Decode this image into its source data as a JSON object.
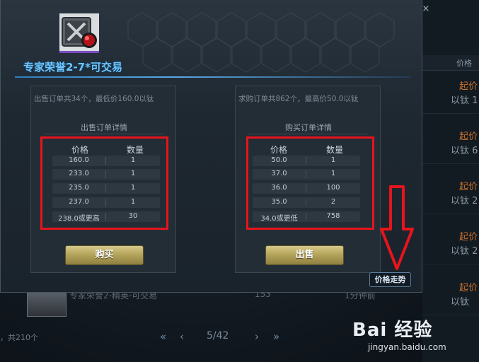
{
  "popup": {
    "title": "专家荣誉2-7*可交易",
    "price_trend_button": "价格走势"
  },
  "sell_panel": {
    "summary": "出售订单共34个，最低价160.0以钛",
    "subtitle": "出售订单详情",
    "col_price": "价格",
    "col_qty": "数量",
    "rows": [
      {
        "price": "160.0",
        "qty": "1"
      },
      {
        "price": "233.0",
        "qty": "1"
      },
      {
        "price": "235.0",
        "qty": "1"
      },
      {
        "price": "237.0",
        "qty": "1"
      },
      {
        "price": "238.0或更高",
        "qty": "30"
      }
    ],
    "action_button": "购买"
  },
  "buy_panel": {
    "summary": "求购订单共862个，最高价50.0以钛",
    "subtitle": "购买订单详情",
    "col_price": "价格",
    "col_qty": "数量",
    "rows": [
      {
        "price": "50.0",
        "qty": "1"
      },
      {
        "price": "37.0",
        "qty": "1"
      },
      {
        "price": "36.0",
        "qty": "100"
      },
      {
        "price": "35.0",
        "qty": "2"
      },
      {
        "price": "34.0或更低",
        "qty": "758"
      }
    ],
    "action_button": "出售"
  },
  "background_list": {
    "header_price": "价格",
    "rows": [
      {
        "line1": "起价",
        "line2": "以钛 1"
      },
      {
        "line1": "起价",
        "line2": "以钛 6"
      },
      {
        "line1": "起价",
        "line2": "以钛 2"
      },
      {
        "line1": "起价",
        "line2": "以钛 2"
      },
      {
        "line1": "起价",
        "line2": "以钛"
      }
    ],
    "bottom_item_name": "专家荣誉2-精英-可交易",
    "bottom_item_count": "153",
    "bottom_item_time": "1分钟前",
    "total": "，共210个"
  },
  "pager": {
    "first": "«",
    "prev": "‹",
    "page": "5/42",
    "next": "›",
    "last": "»"
  },
  "watermark": {
    "logo": "Bai 经验",
    "url": "jingyan.baidu.com"
  },
  "colors": {
    "highlight_box": "#e8141c",
    "title": "#6ec6ff",
    "button_gold": "#b5a55c"
  }
}
